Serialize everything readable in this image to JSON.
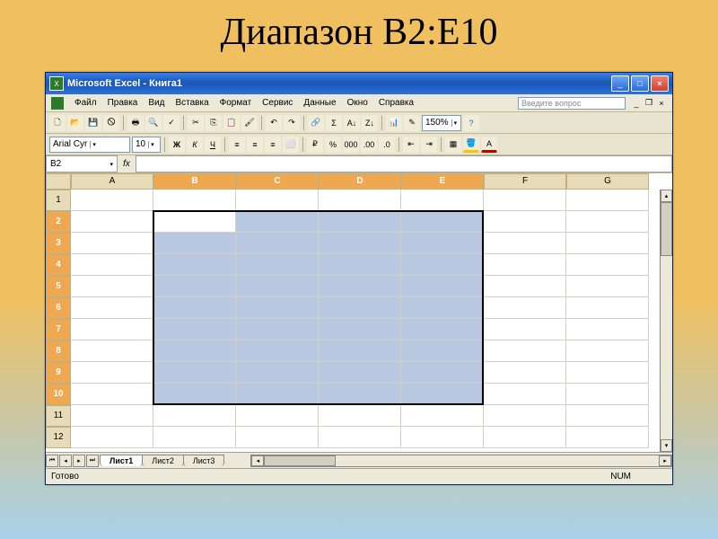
{
  "slide": {
    "title": "Диапазон B2:E10"
  },
  "window": {
    "title": "Microsoft Excel - Книга1",
    "help_placeholder": "Введите вопрос"
  },
  "menu": {
    "items": [
      "Файл",
      "Правка",
      "Вид",
      "Вставка",
      "Формат",
      "Сервис",
      "Данные",
      "Окно",
      "Справка"
    ]
  },
  "toolbar1": {
    "zoom": "150%"
  },
  "toolbar2": {
    "font": "Arial Cyr",
    "size": "10"
  },
  "namebox": {
    "value": "B2"
  },
  "grid": {
    "columns": [
      "A",
      "B",
      "C",
      "D",
      "E",
      "F",
      "G"
    ],
    "rows": [
      "1",
      "2",
      "3",
      "4",
      "5",
      "6",
      "7",
      "8",
      "9",
      "10",
      "11",
      "12"
    ],
    "selected_cols": [
      "B",
      "C",
      "D",
      "E"
    ],
    "selected_rows": [
      "2",
      "3",
      "4",
      "5",
      "6",
      "7",
      "8",
      "9",
      "10"
    ],
    "active_cell": "B2",
    "selection_range": "B2:E10"
  },
  "sheets": {
    "tabs": [
      "Лист1",
      "Лист2",
      "Лист3"
    ],
    "active": "Лист1"
  },
  "status": {
    "ready": "Готово",
    "num": "NUM"
  },
  "icons": {
    "minimize": "_",
    "maximize": "□",
    "close": "×",
    "chevron_down": "▾",
    "chevron_left": "◂",
    "chevron_right": "▸",
    "chevron_up": "▴",
    "fx": "fx"
  }
}
